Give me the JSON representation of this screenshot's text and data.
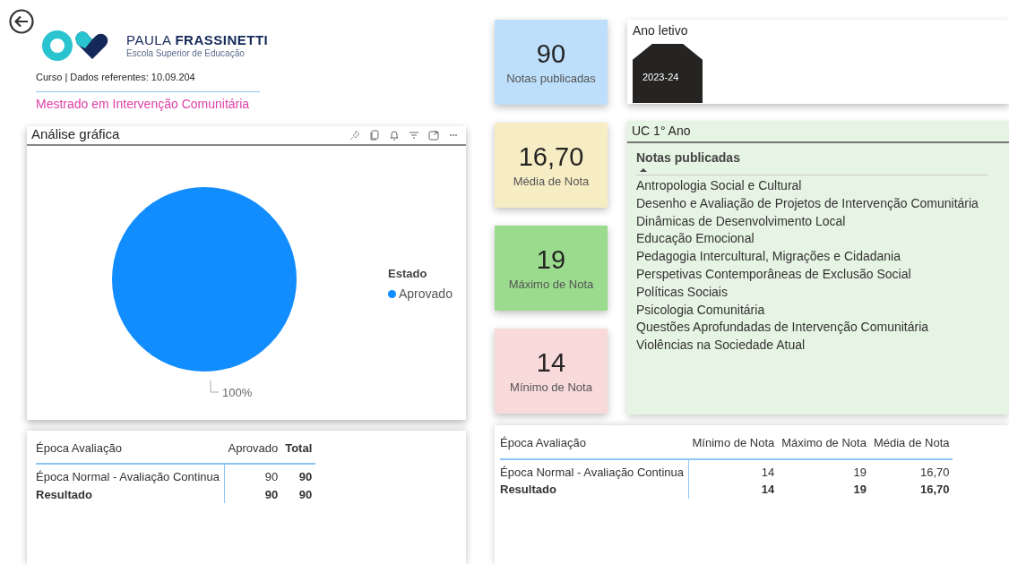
{
  "logo": {
    "name_light": "PAULA",
    "name_bold": "FRASSINETTI",
    "subtitle": "Escola Superior de Educação"
  },
  "course_info": "Curso | Dados referentes: 10.09.204",
  "course_name": "Mestrado em Intervenção Comunitária",
  "chart_card": {
    "title": "Análise gráfica",
    "chart_data": {
      "type": "pie",
      "categories": [
        "Aprovado"
      ],
      "series": [
        {
          "name": "Estado",
          "color": "#118dff",
          "values": [
            100
          ]
        }
      ],
      "value_labels": [
        "100%"
      ]
    }
  },
  "kpis": [
    {
      "value": "90",
      "label": "Notas publicadas",
      "color": "#bddffc"
    },
    {
      "value": "16,70",
      "label": "Média de Nota",
      "color": "#f7edc4"
    },
    {
      "value": "19",
      "label": "Máximo de Nota",
      "color": "#9bdb8e"
    },
    {
      "value": "14",
      "label": "Mínimo de Nota",
      "color": "#f9dada"
    }
  ],
  "year_slicer": {
    "title": "Ano letivo",
    "options": [
      {
        "label": "2023-24",
        "selected": true
      }
    ]
  },
  "uc_list": {
    "title": "UC 1° Ano",
    "column": "Notas publicadas",
    "sorted_ascending": true,
    "items": [
      "Antropologia Social e Cultural",
      "Desenho e Avaliação de Projetos de Intervenção Comunitária",
      "Dinâmicas de Desenvolvimento Local",
      "Educação Emocional",
      "Pedagogia Intercultural, Migrações e Cidadania",
      "Perspetivas Contemporâneas de Exclusão Social",
      "Políticas Sociais",
      "Psicologia Comunitária",
      "Questões Aprofundadas de Intervenção Comunitária",
      "Violências na Sociedade Atual"
    ]
  },
  "tables": [
    {
      "columns": [
        {
          "label": "Época Avaliação",
          "bold": false
        },
        {
          "label": "Aprovado",
          "bold": false
        },
        {
          "label": "Total",
          "bold": true
        }
      ],
      "rows": [
        {
          "kind": "data",
          "cells": [
            "Época Normal - Avaliação Continua",
            "90",
            "90"
          ]
        },
        {
          "kind": "total",
          "cells": [
            "Resultado",
            "90",
            "90"
          ]
        }
      ]
    },
    {
      "columns": [
        {
          "label": "Época Avaliação",
          "bold": false
        },
        {
          "label": "Mínimo de Nota",
          "bold": false
        },
        {
          "label": "Máximo de Nota",
          "bold": false
        },
        {
          "label": "Média de Nota",
          "bold": false
        }
      ],
      "rows": [
        {
          "kind": "data",
          "cells": [
            "Época Normal - Avaliação Continua",
            "14",
            "19",
            "16,70"
          ]
        },
        {
          "kind": "total",
          "cells": [
            "Resultado",
            "14",
            "19",
            "16,70"
          ]
        }
      ]
    }
  ]
}
